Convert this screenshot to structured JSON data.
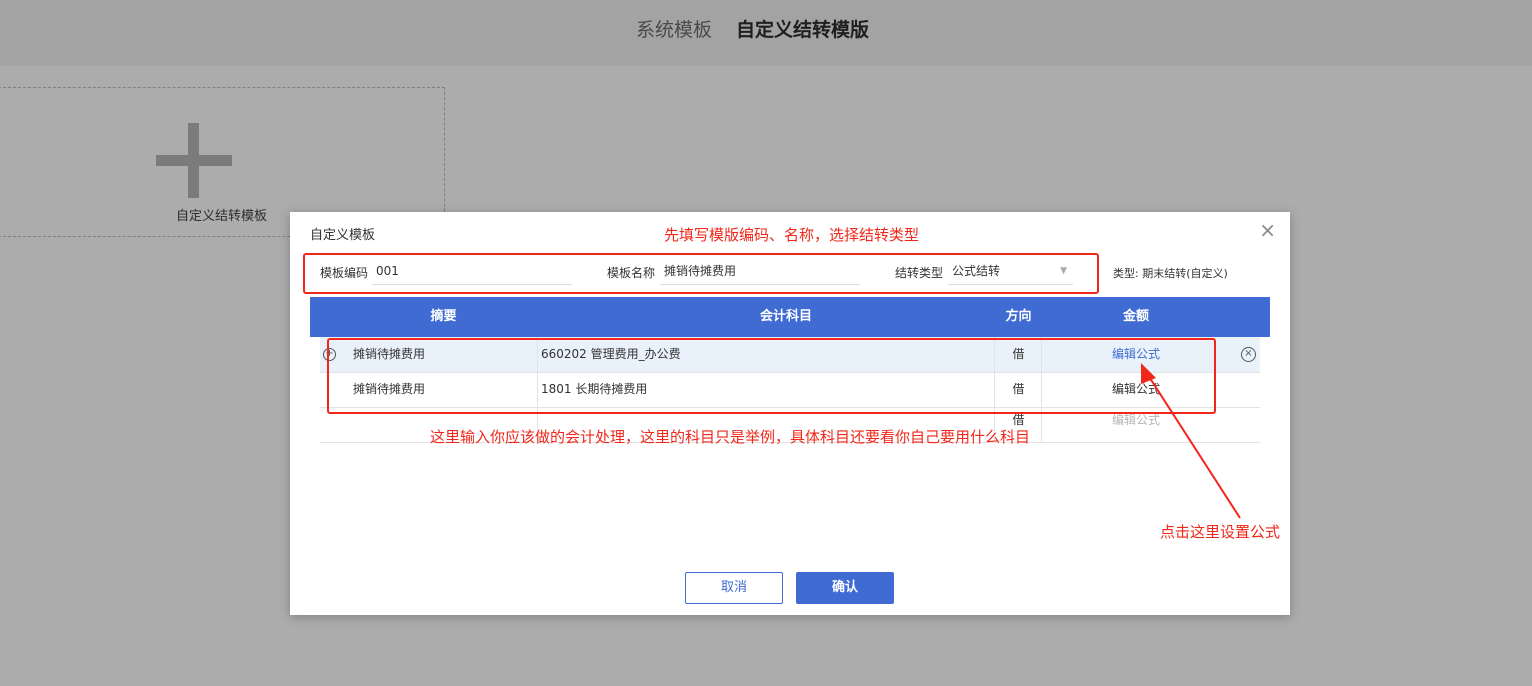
{
  "tabs": {
    "system": "系统模板",
    "custom": "自定义结转模版"
  },
  "add_card": {
    "label": "自定义结转模板"
  },
  "dialog": {
    "title": "自定义模板",
    "close": "×",
    "fields": {
      "code_label": "模板编码",
      "code_value": "001",
      "name_label": "模板名称",
      "name_value": "摊销待摊费用",
      "type_label": "结转类型",
      "type_value": "公式结转",
      "type_info": "类型: 期末结转(自定义)"
    },
    "table": {
      "headers": [
        "摘要",
        "会计科目",
        "方向",
        "金额"
      ],
      "rows": [
        {
          "summary": "摊销待摊费用",
          "account": "660202 管理费用_办公费",
          "direction": "借",
          "amount": "编辑公式"
        },
        {
          "summary": "摊销待摊费用",
          "account": "1801 长期待摊费用",
          "direction": "借",
          "amount": "编辑公式"
        },
        {
          "summary": "",
          "account": "",
          "direction": "借",
          "amount": "编辑公式"
        }
      ]
    },
    "buttons": {
      "cancel": "取消",
      "confirm": "确认"
    }
  },
  "annotations": {
    "top": "先填写模版编码、名称，选择结转类型",
    "middle": "这里输入你应该做的会计处理，这里的科目只是举例，具体科目还要看你自己要用什么科目",
    "right": "点击这里设置公式",
    "color": "#f0271a"
  },
  "colors": {
    "primary": "#3f6bd3",
    "overlay": "#acacac"
  }
}
